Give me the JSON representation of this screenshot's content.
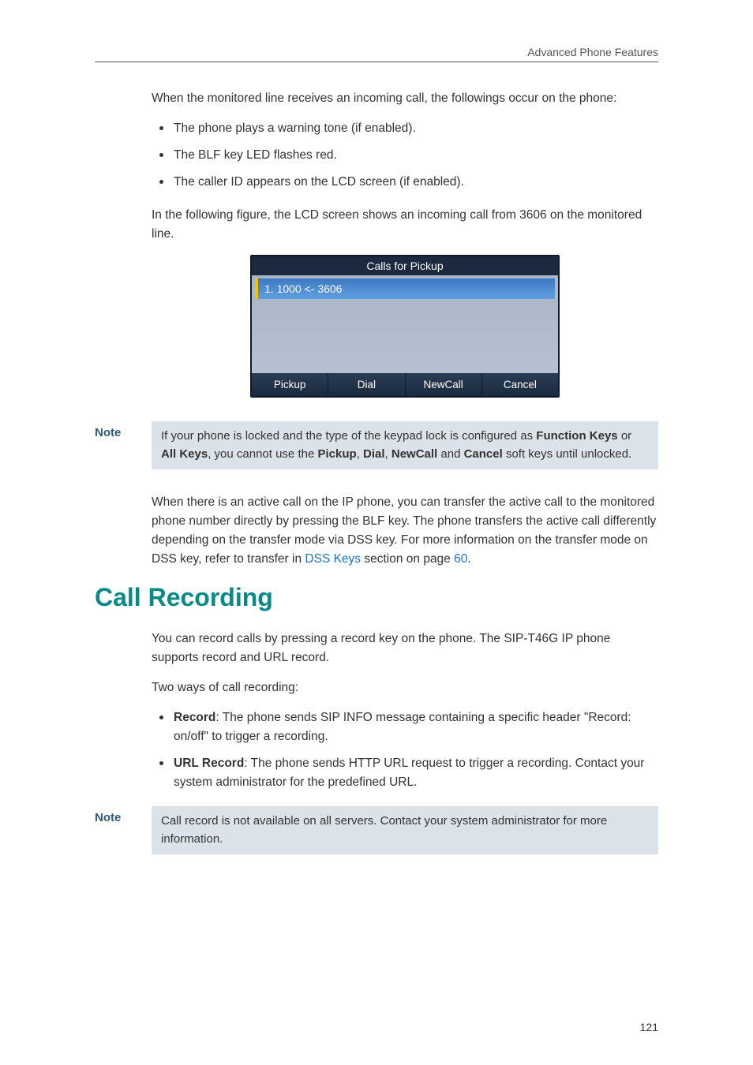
{
  "header": {
    "title": "Advanced Phone Features"
  },
  "intro": {
    "lead": "When the monitored line receives an incoming call, the followings occur on the phone:",
    "bullets": [
      "The phone plays a warning tone (if enabled).",
      "The BLF key LED flashes red.",
      "The caller ID appears on the LCD screen (if enabled)."
    ],
    "figure_lead": "In the following figure, the LCD screen shows an incoming call from 3606 on the monitored line."
  },
  "lcd": {
    "title": "Calls for Pickup",
    "item": "1. 1000 <- 3606",
    "softkeys": {
      "pickup": "Pickup",
      "dial": "Dial",
      "newcall": "NewCall",
      "cancel": "Cancel"
    }
  },
  "note1": {
    "label": "Note",
    "text_pre": "If your phone is locked and the type of the keypad lock is configured as ",
    "b1": "Function Keys",
    "mid1": " or ",
    "b2": "All Keys",
    "mid2": ", you cannot use the ",
    "b3": "Pickup",
    "sep1": ", ",
    "b4": "Dial",
    "sep2": ", ",
    "b5": "NewCall",
    "mid3": " and ",
    "b6": "Cancel",
    "tail": " soft keys until unlocked."
  },
  "transfer": {
    "p_pre": "When there is an active call on the IP phone, you can transfer the active call to the monitored phone number directly by pressing the BLF key. The phone transfers the active call differently depending on the transfer mode via DSS key. For more information on the transfer mode on DSS key, refer to transfer in ",
    "link1": "DSS Keys",
    "p_mid": " section on page ",
    "link2": "60",
    "p_post": "."
  },
  "section": {
    "heading": "Call Recording"
  },
  "recording": {
    "p1": "You can record calls by pressing a record key on the phone. The SIP-T46G IP phone supports record and URL record.",
    "p2": "Two ways of call recording:",
    "bullets": [
      {
        "b": "Record",
        "text": ": The phone sends SIP INFO message containing a specific header \"Record: on/off\" to trigger a recording."
      },
      {
        "b": "URL Record",
        "text": ": The phone sends HTTP URL request to trigger a recording. Contact your system administrator for the predefined URL."
      }
    ]
  },
  "note2": {
    "label": "Note",
    "text": "Call record is not available on all servers. Contact your system administrator for more information."
  },
  "footer": {
    "pagenum": "121"
  }
}
